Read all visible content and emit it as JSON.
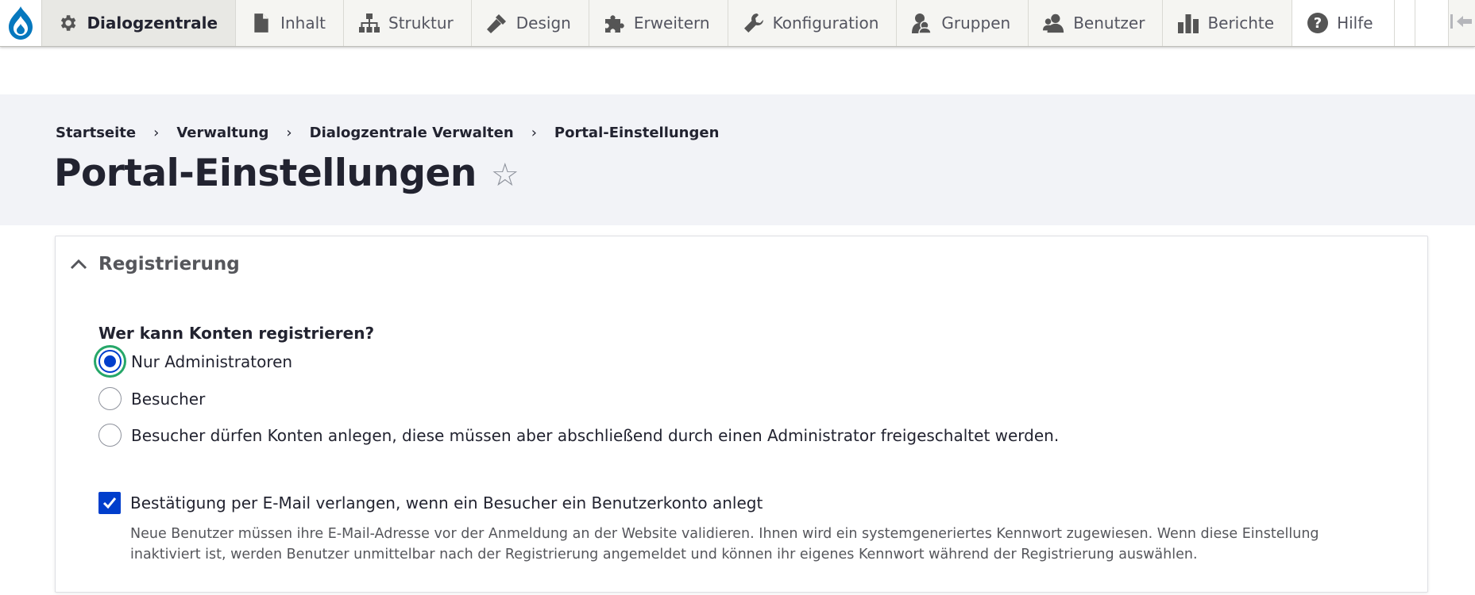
{
  "toolbar": {
    "items": [
      {
        "label": "Dialogzentrale",
        "icon": "gear-icon"
      },
      {
        "label": "Inhalt",
        "icon": "file-icon"
      },
      {
        "label": "Struktur",
        "icon": "structure-icon"
      },
      {
        "label": "Design",
        "icon": "paintbrush-icon"
      },
      {
        "label": "Erweitern",
        "icon": "puzzle-icon"
      },
      {
        "label": "Konfiguration",
        "icon": "wrench-icon"
      },
      {
        "label": "Gruppen",
        "icon": "group-icon"
      },
      {
        "label": "Benutzer",
        "icon": "user-icon"
      },
      {
        "label": "Berichte",
        "icon": "bar-chart-icon"
      },
      {
        "label": "Hilfe",
        "icon": "help-icon"
      }
    ]
  },
  "breadcrumb": {
    "items": [
      "Startseite",
      "Verwaltung",
      "Dialogzentrale Verwalten",
      "Portal-Einstellungen"
    ],
    "separator": "›"
  },
  "page": {
    "title": "Portal-Einstellungen",
    "star": "☆"
  },
  "registration": {
    "summary": "Registrierung",
    "legend": "Wer kann Konten registrieren?",
    "options": [
      {
        "label": "Nur Administratoren",
        "checked": true
      },
      {
        "label": "Besucher",
        "checked": false
      },
      {
        "label": "Besucher dürfen Konten anlegen, diese müssen aber abschließend durch einen Administrator freigeschaltet werden.",
        "checked": false
      }
    ],
    "email_verification": {
      "label": "Bestätigung per E-Mail verlangen, wenn ein Besucher ein Benutzerkonto anlegt",
      "checked": true,
      "description": "Neue Benutzer müssen ihre E-Mail-Adresse vor der Anmeldung an der Website validieren. Ihnen wird ein systemgeneriertes Kennwort zugewiesen. Wenn diese Einstellung inaktiviert ist, werden Benutzer unmittelbar nach der Registrierung angemeldet und können ihr eigenes Kennwort während der Registrierung auswählen."
    }
  },
  "colors": {
    "accent": "#003ecc",
    "focus_ring": "#26a769",
    "drupal_blue": "#0678be"
  }
}
